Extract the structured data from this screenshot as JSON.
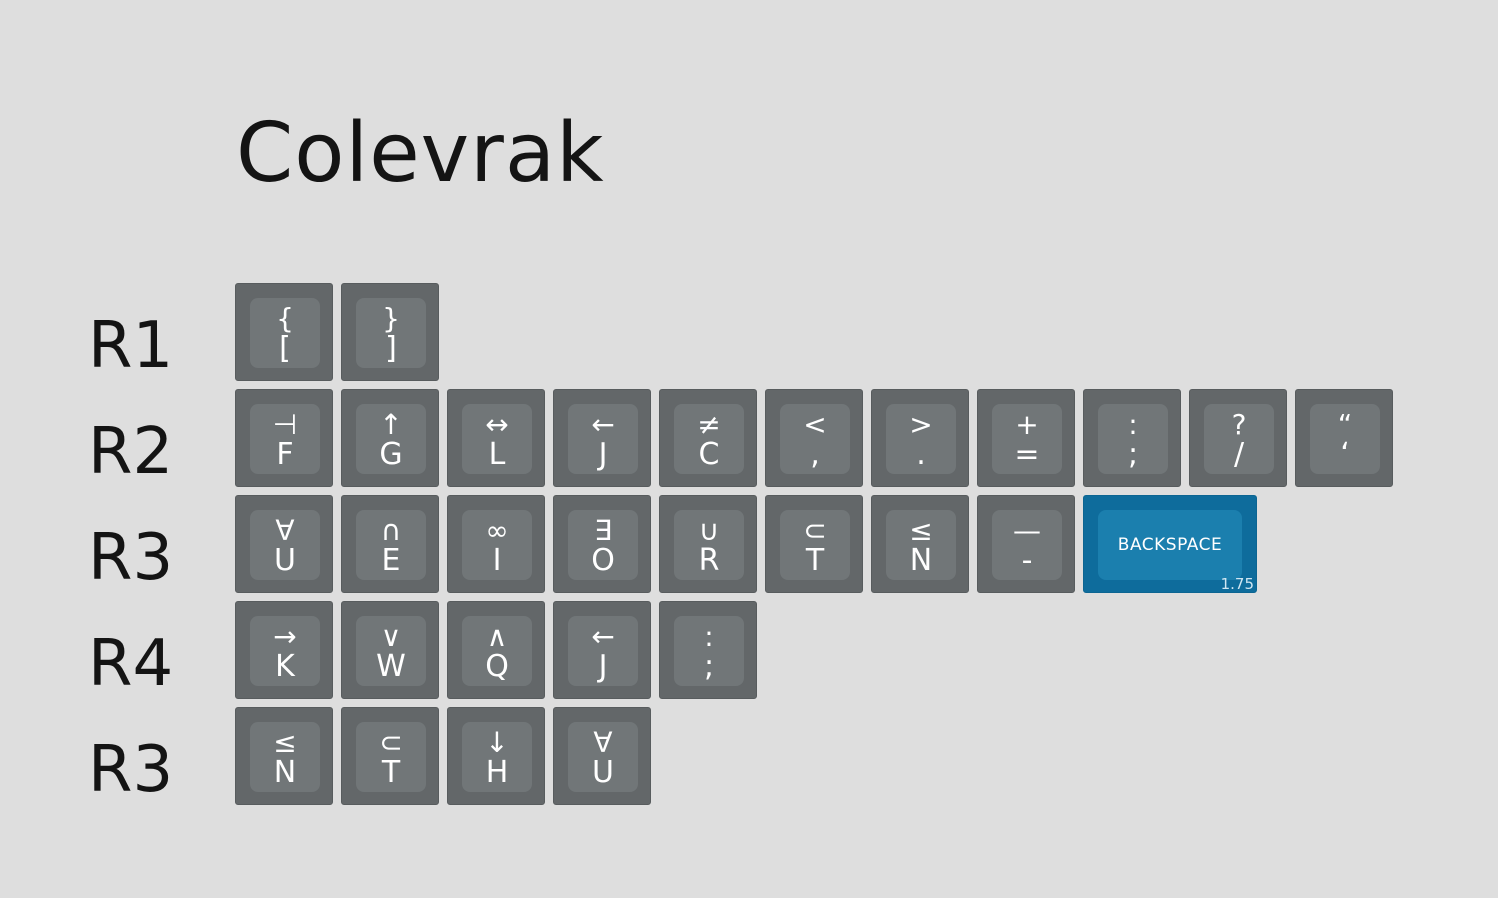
{
  "title": "Colevrak",
  "rows": [
    {
      "label": "R1",
      "keys": [
        {
          "top": "{",
          "bottom": "["
        },
        {
          "top": "}",
          "bottom": "]"
        }
      ]
    },
    {
      "label": "R2",
      "keys": [
        {
          "top": "⊣",
          "bottom": "F"
        },
        {
          "top": "↑",
          "bottom": "G"
        },
        {
          "top": "↔",
          "bottom": "L"
        },
        {
          "top": "←",
          "bottom": "J"
        },
        {
          "top": "≠",
          "bottom": "C"
        },
        {
          "top": "<",
          "bottom": ","
        },
        {
          "top": ">",
          "bottom": "."
        },
        {
          "top": "+",
          "bottom": "="
        },
        {
          "top": ":",
          "bottom": ";"
        },
        {
          "top": "?",
          "bottom": "/"
        },
        {
          "top": "“",
          "bottom": "‘"
        }
      ]
    },
    {
      "label": "R3",
      "keys": [
        {
          "top": "∀",
          "bottom": "U"
        },
        {
          "top": "∩",
          "bottom": "E"
        },
        {
          "top": "∞",
          "bottom": "I"
        },
        {
          "top": "∃",
          "bottom": "O"
        },
        {
          "top": "∪",
          "bottom": "R"
        },
        {
          "top": "⊂",
          "bottom": "T"
        },
        {
          "top": "≤",
          "bottom": "N"
        },
        {
          "top": "—",
          "bottom": "-"
        },
        {
          "label": "BACKSPACE",
          "size": "1.75",
          "color": "#1b7fae"
        }
      ]
    },
    {
      "label": "R4",
      "keys": [
        {
          "top": "→",
          "bottom": "K"
        },
        {
          "top": "∨",
          "bottom": "W"
        },
        {
          "top": "∧",
          "bottom": "Q"
        },
        {
          "top": "←",
          "bottom": "J"
        },
        {
          "top": ":",
          "bottom": ";"
        }
      ]
    },
    {
      "label": "R3",
      "keys": [
        {
          "top": "≤",
          "bottom": "N"
        },
        {
          "top": "⊂",
          "bottom": "T"
        },
        {
          "top": "↓",
          "bottom": "H"
        },
        {
          "top": "∀",
          "bottom": "U"
        }
      ]
    }
  ]
}
